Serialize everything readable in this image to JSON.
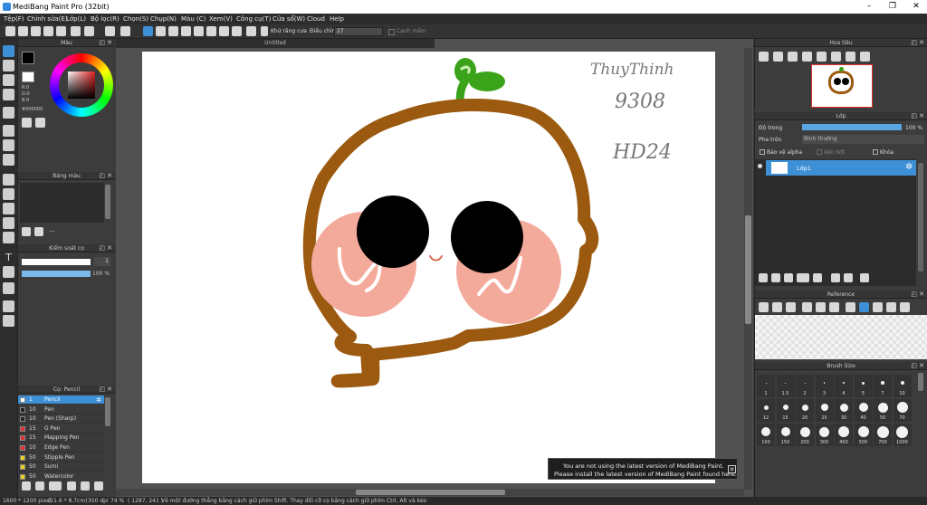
{
  "window": {
    "title": "MediBang Paint Pro (32bit)"
  },
  "menu": [
    "Tệp(F)",
    "Chỉnh sửa(E)",
    "Lớp(L)",
    "Bộ lọc(R)",
    "Chọn(S)",
    "Chụp(N)",
    "Màu (C)",
    "Xem(V)",
    "Công cụ(T)",
    "Cửa sổ(W)",
    "Cloud",
    "Help"
  ],
  "toolbar": {
    "antialias_label": "Khử răng cưa",
    "adjust_label": "Điều chỉnh",
    "adjust_value": "27",
    "edge_label": "Cạnh mềm"
  },
  "tabs": {
    "canvas_tab": "Untitled"
  },
  "color_panel": {
    "title": "Màu",
    "r": "R:0",
    "g": "G:0",
    "b": "B:0",
    "hex": "#000000",
    "fg_color": "#000000",
    "bg_color": "#ffffff"
  },
  "palette_panel": {
    "title": "Bảng màu",
    "dash": "---"
  },
  "brush_control": {
    "title": "Kiểm soát cọ",
    "size_value": "1",
    "opacity_value": "100 %"
  },
  "brush_panel": {
    "title": "Cọ: Pencil",
    "items": [
      {
        "size": "1",
        "name": "Pencil",
        "color": "#ffffff",
        "selected": true
      },
      {
        "size": "10",
        "name": "Pen",
        "color": "#222222"
      },
      {
        "size": "10",
        "name": "Pen (Sharp)",
        "color": "#222222"
      },
      {
        "size": "15",
        "name": "G Pen",
        "color": "#e03030"
      },
      {
        "size": "15",
        "name": "Mapping Pen",
        "color": "#e03030"
      },
      {
        "size": "10",
        "name": "Edge Pen",
        "color": "#e03030"
      },
      {
        "size": "50",
        "name": "Stipple Pen",
        "color": "#f0d020"
      },
      {
        "size": "50",
        "name": "Sumi",
        "color": "#f0d020"
      },
      {
        "size": "50",
        "name": "Watercolor",
        "color": "#f0d020"
      }
    ]
  },
  "navigator_panel": {
    "title": "Hoa tiêu"
  },
  "layer_panel": {
    "title": "Lớp",
    "opacity_label": "Độ trong",
    "opacity_value": "100 %",
    "blend_label": "Pha trộn",
    "blend_value": "Bình thường",
    "protect_alpha": "Bảo vệ alpha",
    "clipping": "Xén bớt",
    "lock": "Khóa",
    "layers": [
      {
        "name": "Lớp1"
      }
    ]
  },
  "reference_panel": {
    "title": "Reference"
  },
  "brushsize_panel": {
    "title": "Brush Size",
    "sizes": [
      "1",
      "1.5",
      "2",
      "3",
      "4",
      "5",
      "7",
      "10",
      "12",
      "15",
      "20",
      "25",
      "30",
      "40",
      "50",
      "70",
      "100",
      "150",
      "200",
      "300",
      "400",
      "500",
      "700",
      "1000"
    ]
  },
  "notification": {
    "line1": "You are not using the latest version of MediBang Paint.",
    "line2": "Please install the latest version of MediBang Paint found here."
  },
  "status": {
    "dimensions": "1600 * 1200 pixel",
    "physical": "(11.6 * 8.7cm)",
    "dpi": "350 dpi",
    "zoom": "74 %",
    "coords": "( 1287, 241 )",
    "hint": "Vẽ một đường thẳng bằng cách giữ phím Shift. Thay đổi cỡ cọ bằng cách giữ phím Ctrl, Alt và kéo"
  },
  "canvas_text": {
    "name": "ThuyThinh",
    "code": "9308",
    "class": "HD24"
  },
  "colors": {
    "accent": "#3d8fd6",
    "stroke": "#9b5a10",
    "sprout": "#3aa31a",
    "cheek": "#f4aa9a"
  }
}
